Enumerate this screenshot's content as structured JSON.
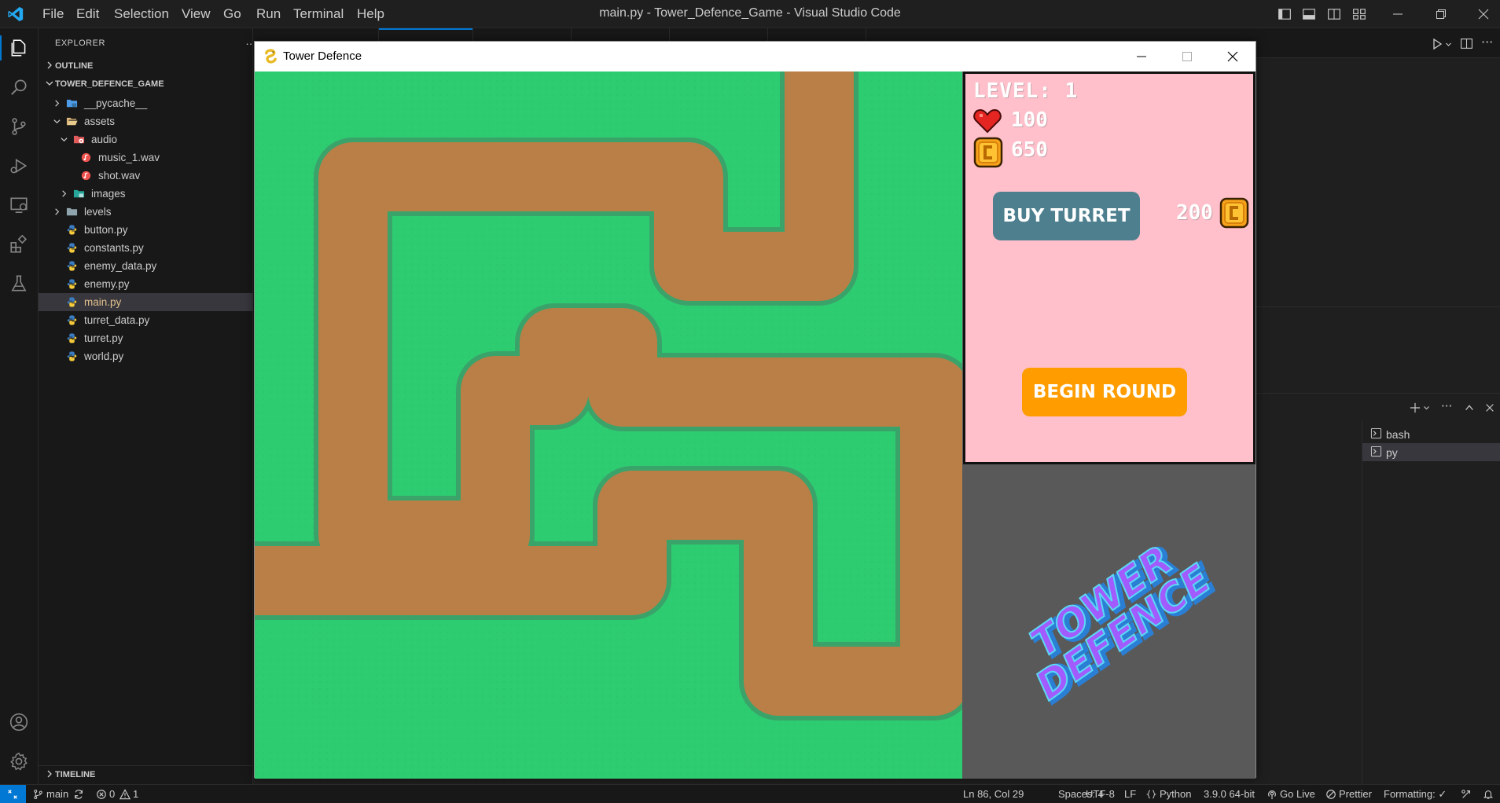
{
  "titlebar": {
    "menu": [
      "File",
      "Edit",
      "Selection",
      "View",
      "Go",
      "Run",
      "Terminal",
      "Help"
    ],
    "window_title": "main.py - Tower_Defence_Game - Visual Studio Code"
  },
  "sidebar": {
    "explorer_title": "EXPLORER",
    "more": "…",
    "outline_label": "OUTLINE",
    "project_label": "TOWER_DEFENCE_GAME",
    "timeline_label": "TIMELINE",
    "tree": [
      {
        "name": "__pycache__",
        "type": "folder-blue",
        "expanded": false
      },
      {
        "name": "assets",
        "type": "folder",
        "expanded": true
      },
      {
        "name": "audio",
        "type": "folder-red",
        "expanded": true
      },
      {
        "name": "music_1.wav",
        "type": "audio-file"
      },
      {
        "name": "shot.wav",
        "type": "audio-file"
      },
      {
        "name": "images",
        "type": "folder-teal",
        "expanded": false
      },
      {
        "name": "levels",
        "type": "folder-gray",
        "expanded": false
      },
      {
        "name": "button.py",
        "type": "python-file"
      },
      {
        "name": "constants.py",
        "type": "python-file"
      },
      {
        "name": "enemy_data.py",
        "type": "python-file"
      },
      {
        "name": "enemy.py",
        "type": "python-file"
      },
      {
        "name": "main.py",
        "type": "python-file",
        "selected": true
      },
      {
        "name": "turret_data.py",
        "type": "python-file"
      },
      {
        "name": "turret.py",
        "type": "python-file"
      },
      {
        "name": "world.py",
        "type": "python-file"
      }
    ]
  },
  "terminal": {
    "instances": [
      "bash",
      "py"
    ],
    "active": "py"
  },
  "statusbar": {
    "branch": "main",
    "problems_errors": "0",
    "problems_warnings": "1",
    "cursor": "Ln 86, Col 29",
    "spaces": "Spaces: 4",
    "encoding": "UTF-8",
    "eol": "LF",
    "language": "Python",
    "interpreter": "3.9.0 64-bit",
    "go_live": "Go Live",
    "prettier": "Prettier",
    "formatting": "Formatting: ✓"
  },
  "game": {
    "window_title": "Tower Defence",
    "level_text": "LEVEL: 1",
    "health": "100",
    "money": "650",
    "buy_turret_label": "BUY TURRET",
    "turret_cost": "200",
    "begin_round_label": "BEGIN ROUND",
    "logo_line1": "TOWER",
    "logo_line2": "DEFENCE"
  },
  "colors": {
    "vscode_accent": "#0078d4",
    "grass": "#2ecc71",
    "path": "#b97f46",
    "info_panel": "#ffc0cb",
    "buy_button": "#4d7f8e",
    "begin_button": "#ff9c00",
    "side_panel": "#595959"
  }
}
